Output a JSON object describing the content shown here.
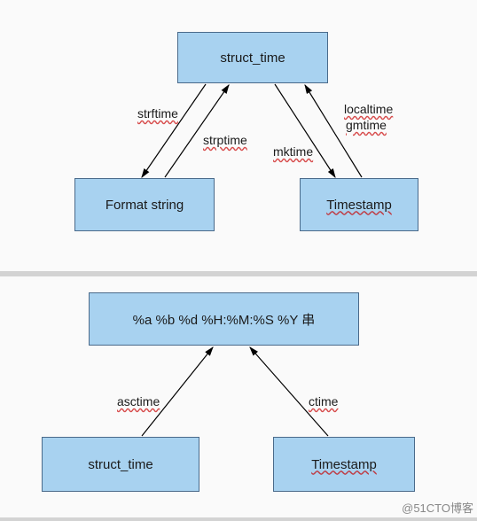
{
  "diagram1": {
    "nodes": {
      "struct_time": "struct_time",
      "format_string": "Format string",
      "timestamp": "Timestamp"
    },
    "edges": {
      "strftime": "strftime",
      "strptime": "strptime",
      "mktime": "mktime",
      "localtime": "localtime",
      "gmtime": "gmtime"
    }
  },
  "diagram2": {
    "nodes": {
      "format_pattern": "%a %b %d %H:%M:%S %Y 串",
      "struct_time": "struct_time",
      "timestamp": "Timestamp"
    },
    "edges": {
      "asctime": "asctime",
      "ctime": "ctime"
    }
  },
  "watermark": "@51CTO博客"
}
